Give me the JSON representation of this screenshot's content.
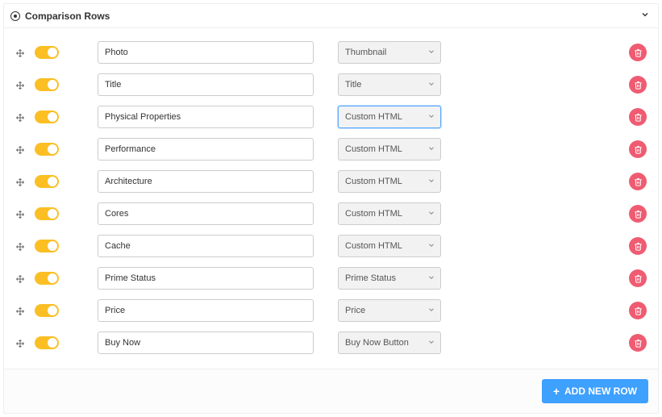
{
  "panel": {
    "title": "Comparison Rows",
    "add_button_label": "ADD NEW ROW",
    "focused_row_index": 2
  },
  "rows": [
    {
      "enabled": true,
      "name": "Photo",
      "type": "Thumbnail"
    },
    {
      "enabled": true,
      "name": "Title",
      "type": "Title"
    },
    {
      "enabled": true,
      "name": "Physical Properties",
      "type": "Custom HTML"
    },
    {
      "enabled": true,
      "name": "Performance",
      "type": "Custom HTML"
    },
    {
      "enabled": true,
      "name": "Architecture",
      "type": "Custom HTML"
    },
    {
      "enabled": true,
      "name": "Cores",
      "type": "Custom HTML"
    },
    {
      "enabled": true,
      "name": "Cache",
      "type": "Custom HTML"
    },
    {
      "enabled": true,
      "name": "Prime Status",
      "type": "Prime Status"
    },
    {
      "enabled": true,
      "name": "Price",
      "type": "Price"
    },
    {
      "enabled": true,
      "name": "Buy Now",
      "type": "Buy Now Button"
    }
  ]
}
